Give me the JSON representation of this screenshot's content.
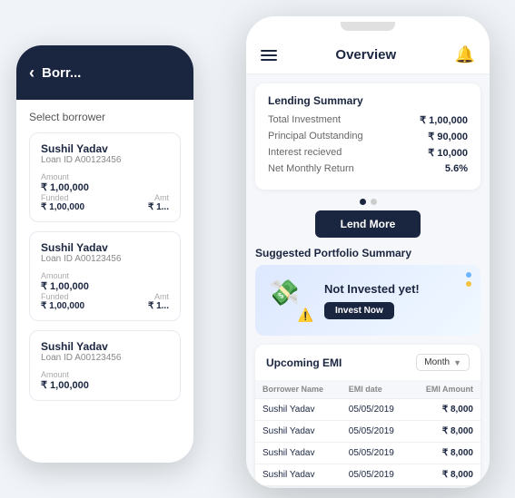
{
  "back_phone": {
    "header": {
      "back_label": "‹",
      "title": "Borr..."
    },
    "select_label": "Select borrower",
    "borrowers": [
      {
        "name": "Sushil Yadav",
        "loan_id": "Loan ID  A00123456",
        "amount_label": "Amount",
        "amount": "₹ 1,00,000",
        "funded_label": "Funded",
        "funded": "₹ 1,00,000",
        "amt_label": "Amt",
        "amt": "₹ 1..."
      },
      {
        "name": "Sushil Yadav",
        "loan_id": "Loan ID  A00123456",
        "amount_label": "Amount",
        "amount": "₹ 1,00,000",
        "funded_label": "Funded",
        "funded": "₹ 1,00,000",
        "amt_label": "Amt",
        "amt": "₹ 1..."
      },
      {
        "name": "Sushil Yadav",
        "loan_id": "Loan ID  A00123456",
        "amount_label": "Amount",
        "amount": "₹ 1,00,000"
      }
    ]
  },
  "front_phone": {
    "header": {
      "title": "Overview"
    },
    "lending_summary": {
      "title": "Lending Summary",
      "rows": [
        {
          "key": "Total Investment",
          "value": "₹ 1,00,000"
        },
        {
          "key": "Principal Outstanding",
          "value": "₹ 90,000"
        },
        {
          "key": "Interest recieved",
          "value": "₹ 10,000"
        },
        {
          "key": "Net Monthly Return",
          "value": "5.6%"
        }
      ]
    },
    "lend_more_btn": "Lend More",
    "portfolio": {
      "section_title": "Suggested Portfolio Summary",
      "not_invested_text": "Not Invested yet!",
      "invest_now_btn": "Invest Now"
    },
    "emi": {
      "section_title": "Upcoming EMI",
      "filter_label": "Month",
      "table_headers": [
        "Borrower Name",
        "EMI date",
        "EMI Amount"
      ],
      "rows": [
        {
          "name": "Sushil Yadav",
          "date": "05/05/2019",
          "amount": "₹ 8,000"
        },
        {
          "name": "Sushil Yadav",
          "date": "05/05/2019",
          "amount": "₹ 8,000"
        },
        {
          "name": "Sushil Yadav",
          "date": "05/05/2019",
          "amount": "₹ 8,000"
        },
        {
          "name": "Sushil Yadav",
          "date": "05/05/2019",
          "amount": "₹ 8,000"
        }
      ]
    }
  }
}
